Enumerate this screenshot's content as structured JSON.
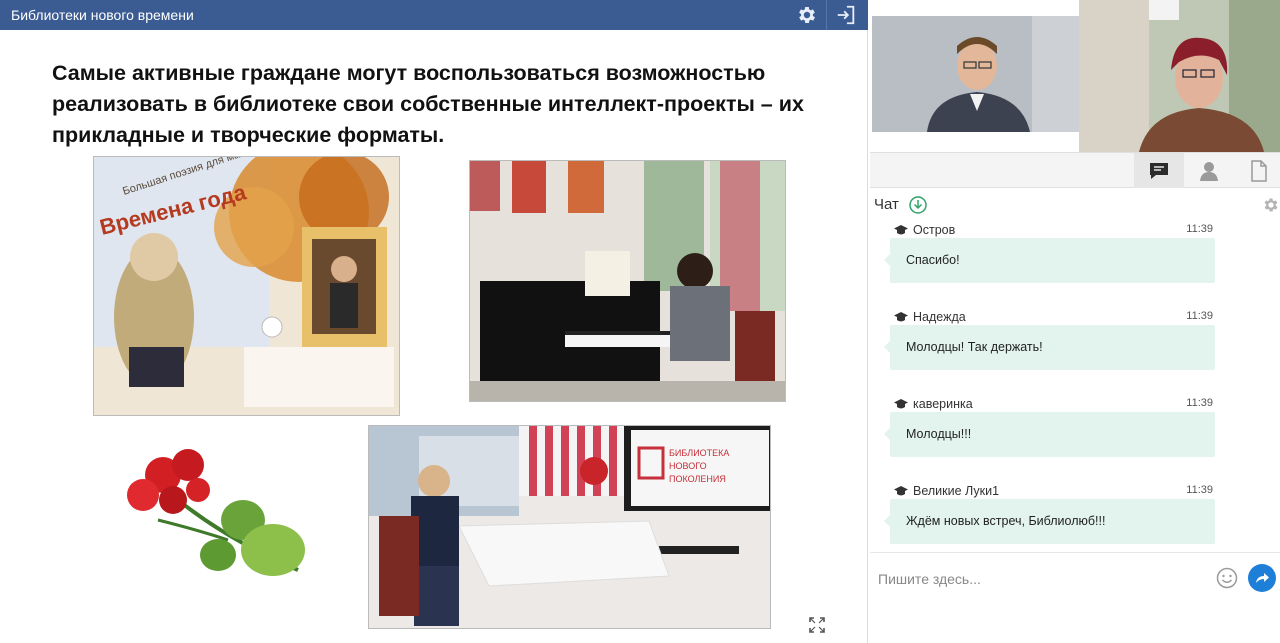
{
  "presentation": {
    "title": "Библиотеки нового времени",
    "slide_heading": "Самые активные граждане могут воспользоваться возможностью реализовать в библиотеке свои собственные интеллект-проекты – их прикладные и творческие форматы.",
    "photo1_book_text": "Большая поэзия для маленьких детей",
    "photo1_book_title": "Времена года",
    "photo4_sign_text": "БИБЛИОТЕКА НОВОГО ПОКОЛЕНИЯ"
  },
  "side": {
    "tabs": [
      "chat",
      "users",
      "files"
    ]
  },
  "chat": {
    "title": "Чат",
    "messages": [
      {
        "author": "Остров",
        "time": "11:39",
        "text": "Спасибо!"
      },
      {
        "author": "Надежда",
        "time": "11:39",
        "text": "Молодцы! Так держать!"
      },
      {
        "author": "каверинка",
        "time": "11:39",
        "text": "Молодцы!!!"
      },
      {
        "author": "Великие Луки1",
        "time": "11:39",
        "text": "Ждём новых встреч, Библиолюб!!!"
      }
    ],
    "input_placeholder": "Пишите здесь..."
  },
  "colors": {
    "header": "#3b5b93",
    "bubble": "#e3f4ee",
    "send": "#1e7fd8"
  }
}
